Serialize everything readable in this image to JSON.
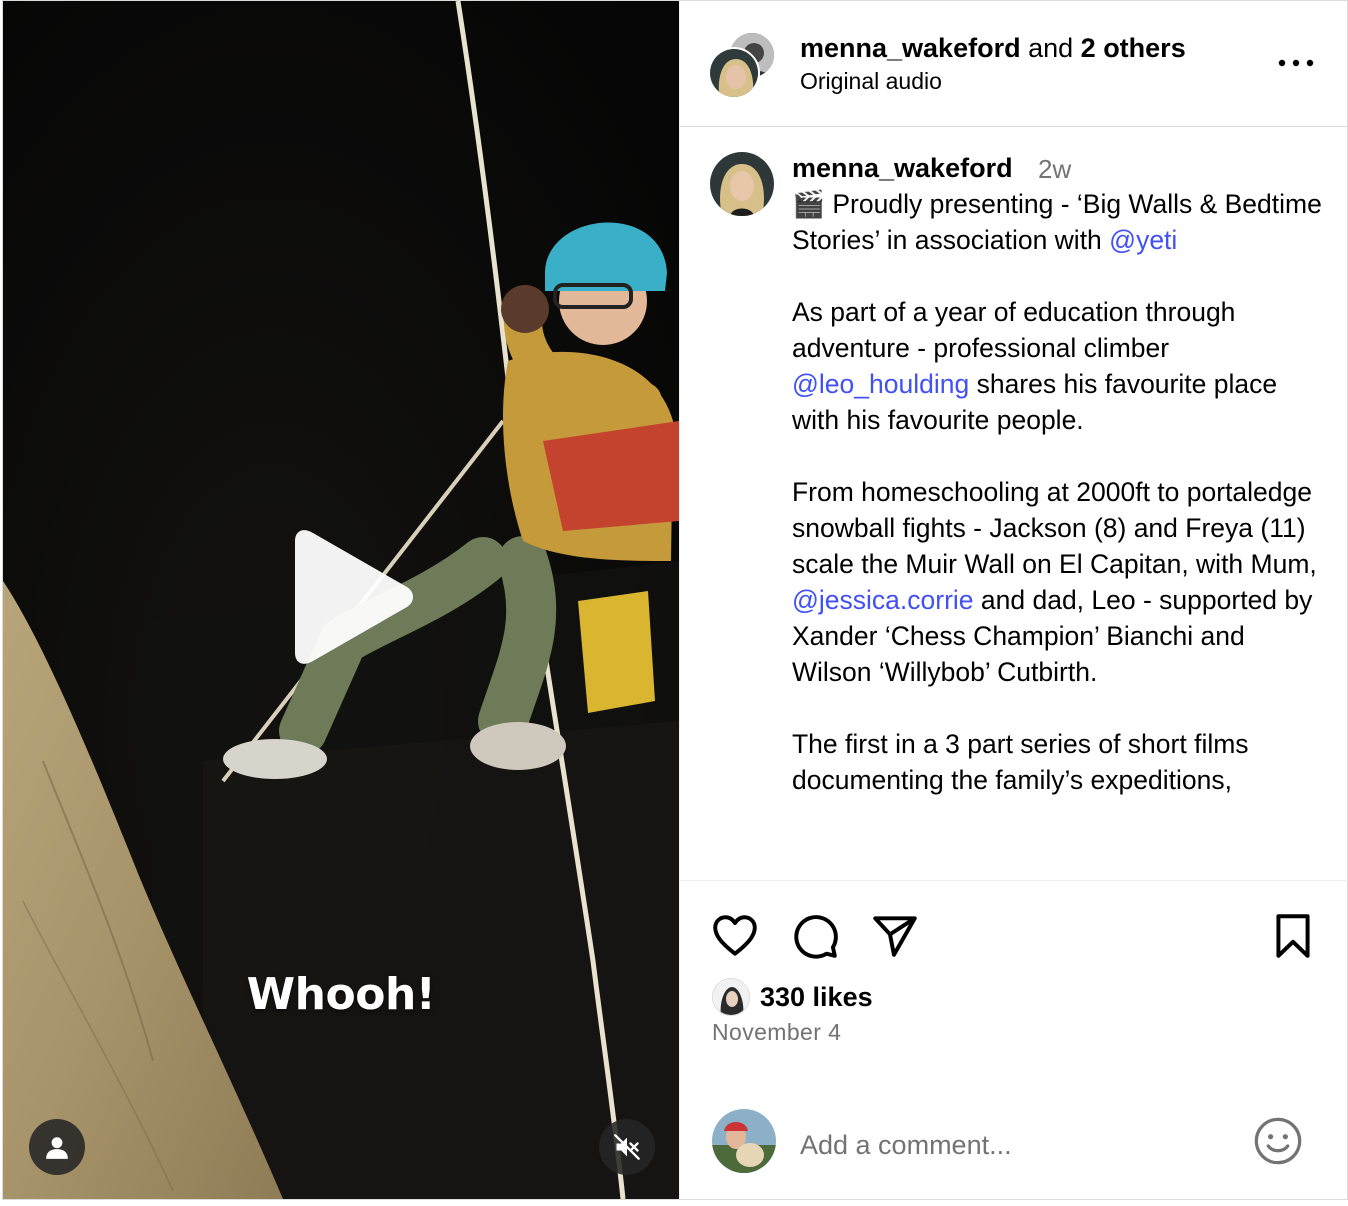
{
  "video": {
    "overlay_caption": "Whooh!",
    "play_icon": "play-icon",
    "user_tag_icon": "user-icon",
    "mute_icon": "speaker-muted-icon"
  },
  "header": {
    "username": "menna_wakeford",
    "joiner": "and",
    "others": "2 others",
    "audio": "Original audio",
    "more_icon": "ellipsis-icon"
  },
  "caption": {
    "username": "menna_wakeford",
    "time": "2w",
    "clapper_emoji": "🎬",
    "parts": [
      {
        "text": " Proudly presenting - ‘Big Walls & Bedtime Stories’ in association with "
      },
      {
        "mention": "@yeti"
      },
      {
        "text": "\n\nAs part of a year of education through adventure - professional climber "
      },
      {
        "mention": "@leo_houlding"
      },
      {
        "text": " shares his favourite place with his favourite people.\n\nFrom homeschooling at 2000ft to portaledge snowball fights - Jackson (8) and Freya (11) scale the Muir Wall on El Capitan, with Mum, "
      },
      {
        "mention": "@jessica.corrie"
      },
      {
        "text": " and dad, Leo - supported by Xander ‘Chess Champion’ Bianchi and Wilson ‘Willybob’ Cutbirth.\n\nThe first in a 3 part series of short films documenting the family’s expeditions, "
      }
    ]
  },
  "actions": {
    "like_icon": "heart-icon",
    "comment_icon": "comment-bubble-icon",
    "share_icon": "paper-plane-icon",
    "save_icon": "bookmark-icon"
  },
  "likes": {
    "count_text": "330 likes"
  },
  "date": "November 4",
  "comment_box": {
    "placeholder": "Add a comment...",
    "emoji_icon": "smiley-icon"
  },
  "colors": {
    "mention": "#4150f7",
    "muted_text": "#737373",
    "divider": "#dbdbdb"
  }
}
